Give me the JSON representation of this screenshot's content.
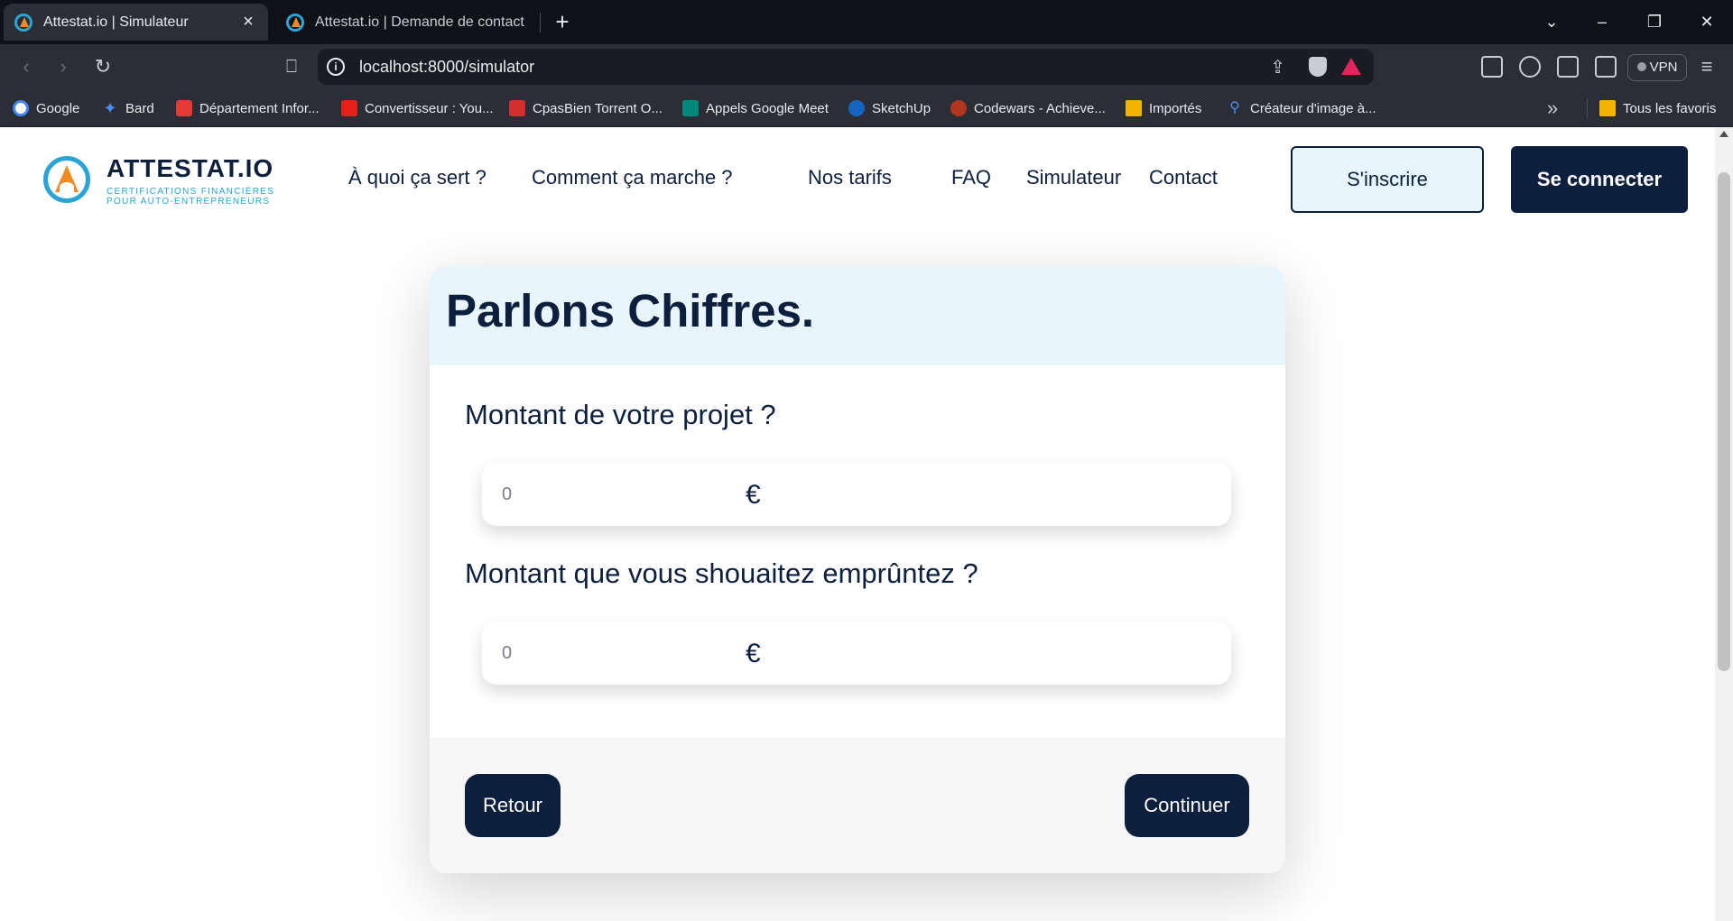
{
  "browser": {
    "tabs": [
      {
        "title": "Attestat.io | Simulateur",
        "active": true
      },
      {
        "title": "Attestat.io | Demande de contact",
        "active": false
      }
    ],
    "url": "localhost:8000/simulator",
    "vpn_label": "VPN",
    "bookmarks": [
      {
        "label": "Google",
        "icon": "google-icon",
        "color": "#4285f4"
      },
      {
        "label": "Bard",
        "icon": "bard-sparkle-icon",
        "color": "#4a8df8"
      },
      {
        "label": "Département Infor...",
        "icon": "hub-icon",
        "color": "#e53935"
      },
      {
        "label": "Convertisseur : You...",
        "icon": "youtube-icon",
        "color": "#e62117"
      },
      {
        "label": "CpasBien Torrent O...",
        "icon": "cpasbien-icon",
        "color": "#d32f2f"
      },
      {
        "label": "Appels Google Meet",
        "icon": "meet-icon",
        "color": "#00897b"
      },
      {
        "label": "SketchUp",
        "icon": "sketchup-icon",
        "color": "#1565c0"
      },
      {
        "label": "Codewars - Achieve...",
        "icon": "codewars-icon",
        "color": "#b1361e"
      },
      {
        "label": "Importés",
        "icon": "folder-icon",
        "color": "#f4b400"
      },
      {
        "label": "Créateur d'image à...",
        "icon": "search-icon",
        "color": "#4a8df8"
      }
    ],
    "bookmarks_all": {
      "label": "Tous les favoris",
      "icon": "folder-icon"
    }
  },
  "site": {
    "logo": {
      "name": "ATTESTAT.IO",
      "tagline_1": "CERTIFICATIONS FINANCIÈRES",
      "tagline_2": "POUR AUTO-ENTREPRENEURS"
    },
    "nav": [
      "À quoi ça sert ?",
      "Comment ça marche ?",
      "Nos tarifs",
      "FAQ",
      "Simulateur",
      "Contact"
    ],
    "signup_label": "S'inscrire",
    "login_label": "Se connecter"
  },
  "form": {
    "title": "Parlons Chiffres.",
    "fields": [
      {
        "label": "Montant de votre projet ?",
        "value": "0",
        "currency": "€"
      },
      {
        "label": "Montant que vous shouaitez emprûntez ?",
        "value": "0",
        "currency": "€"
      }
    ],
    "back_label": "Retour",
    "continue_label": "Continuer"
  },
  "colors": {
    "brand_navy": "#0c1f3d",
    "brand_light_blue": "#e9f5fc",
    "logo_blue": "#2aa4d8",
    "logo_orange": "#f08a24"
  }
}
